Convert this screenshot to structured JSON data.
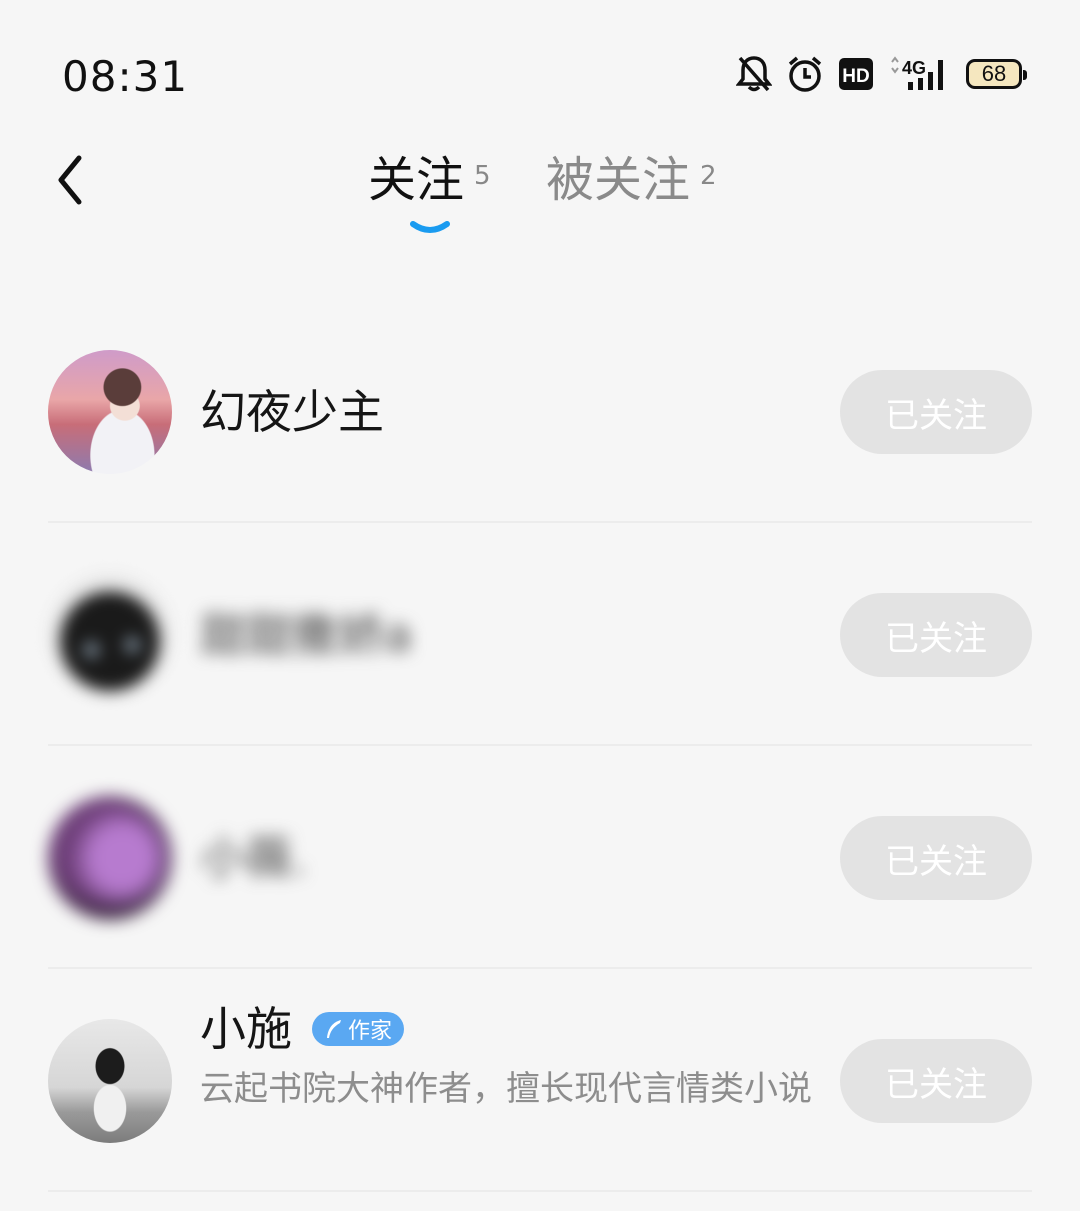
{
  "status_bar": {
    "time": "08:31",
    "battery": "68",
    "network": "4G",
    "hd": "HD",
    "icons": [
      "bell-off-icon",
      "alarm-icon",
      "hd-icon",
      "signal-icon",
      "battery-icon"
    ]
  },
  "header": {
    "back_icon": "chevron-left-icon",
    "tabs": [
      {
        "label": "关注",
        "count": "5",
        "active": true
      },
      {
        "label": "被关注",
        "count": "2",
        "active": false
      }
    ],
    "accent_color": "#1a9bf0"
  },
  "users": [
    {
      "name": "幻夜少主",
      "blurred": false,
      "button": "已关注"
    },
    {
      "name": "甜甜撒娇a",
      "blurred": true,
      "button": "已关注"
    },
    {
      "name": "小薇.",
      "blurred": true,
      "button": "已关注"
    },
    {
      "name": "小施",
      "blurred": false,
      "badge": "作家",
      "bio": "云起书院大神作者，擅长现代言情类小说",
      "button": "已关注"
    }
  ]
}
